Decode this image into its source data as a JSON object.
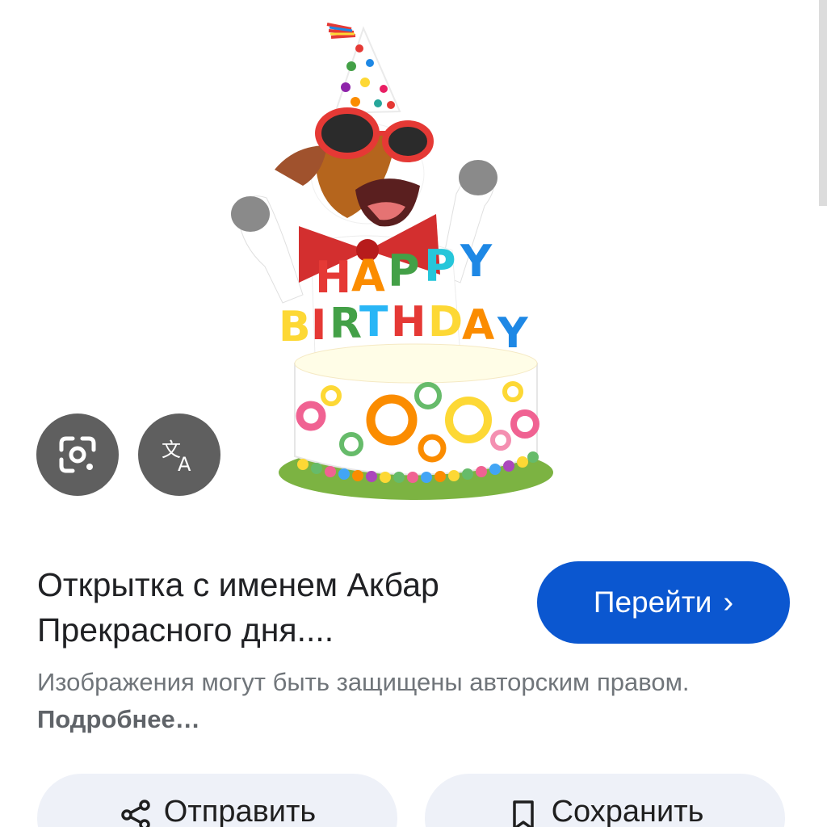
{
  "preview": {
    "lens_icon": "google-lens-icon",
    "translate_icon": "translate-icon",
    "cake_text": {
      "line1": "HAPPY",
      "line2": "BIRTHDAY"
    }
  },
  "result": {
    "title": "Открытка с именем Акбар Прекрасного дня....",
    "go_button_label": "Перейти",
    "go_button_icon": "chevron-right-icon",
    "copyright_text": "Изображения могут быть защищены авторским правом. ",
    "copyright_link": "Подробнее…"
  },
  "actions": {
    "share_label": "Отправить",
    "share_icon": "share-icon",
    "save_label": "Сохранить",
    "save_icon": "bookmark-icon"
  },
  "colors": {
    "accent": "#0b57d0",
    "fab_bg": "#5f5f5f",
    "chip_bg": "#eef1f8"
  }
}
